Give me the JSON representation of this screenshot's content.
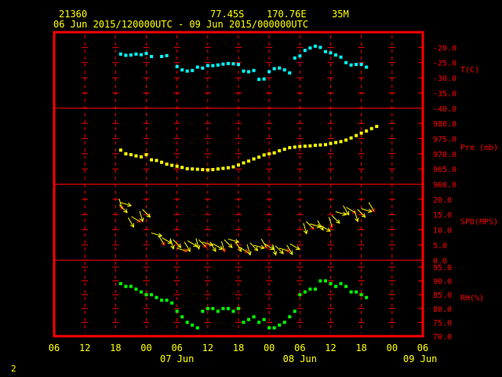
{
  "header": {
    "station": "21360",
    "latitude": "77.45S",
    "longitude": "170.76E",
    "elevation": "35M",
    "time_range": "06 Jun 2015/120000UTC - 09 Jun 2015/000000UTC"
  },
  "footer": {
    "page": "2"
  },
  "colors": {
    "frame": "#ff0000",
    "text": "#ffff00",
    "grid": "#ff0000",
    "temp": "#00ffff",
    "pres": "#ffff00",
    "rh": "#00ff00",
    "wind": "#ffff00",
    "wind_head": "#ff0000"
  },
  "chart_data": {
    "type": "scatter",
    "x_unit": "hours since 06 Jun 2015 00 UTC",
    "xlim": [
      0,
      72
    ],
    "x_tick_labels": [
      "06",
      "12",
      "18",
      "00",
      "06",
      "12",
      "18",
      "00",
      "06",
      "12",
      "18",
      "00",
      "06"
    ],
    "x_day_labels": [
      "07 Jun",
      "08 Jun",
      "09 Jun"
    ],
    "panels": [
      {
        "key": "temp",
        "label": "T(C)",
        "ylim": [
          -40,
          -15
        ],
        "ticks": [
          "-20.0",
          "-25.0",
          "-30.0",
          "-35.0",
          "-40.0"
        ],
        "tick_values": [
          -20,
          -25,
          -30,
          -35,
          -40
        ],
        "points": [
          [
            13,
            -22.2
          ],
          [
            14,
            -22.6
          ],
          [
            15,
            -22.5
          ],
          [
            16,
            -22.2
          ],
          [
            17,
            -22.4
          ],
          [
            18,
            -22
          ],
          [
            19,
            -23
          ],
          [
            21,
            -23
          ],
          [
            22,
            -22.7
          ],
          [
            24,
            -26.3
          ],
          [
            25,
            -27.4
          ],
          [
            26,
            -27.8
          ],
          [
            27,
            -27.6
          ],
          [
            28,
            -26.5
          ],
          [
            29,
            -26.8
          ],
          [
            30,
            -26
          ],
          [
            31,
            -26
          ],
          [
            32,
            -25.8
          ],
          [
            33,
            -25.5
          ],
          [
            34,
            -25.3
          ],
          [
            35,
            -25.4
          ],
          [
            36,
            -25.6
          ],
          [
            37,
            -27.8
          ],
          [
            38,
            -28
          ],
          [
            39,
            -27.6
          ],
          [
            40,
            -30.5
          ],
          [
            41,
            -30.4
          ],
          [
            42,
            -28
          ],
          [
            43,
            -27
          ],
          [
            44,
            -26.8
          ],
          [
            45,
            -27.4
          ],
          [
            46,
            -28.4
          ],
          [
            47,
            -23.5
          ],
          [
            48,
            -22.8
          ],
          [
            49,
            -21
          ],
          [
            50,
            -20.2
          ],
          [
            51,
            -19.6
          ],
          [
            52,
            -20
          ],
          [
            53,
            -21.4
          ],
          [
            54,
            -21.8
          ],
          [
            55,
            -22.5
          ],
          [
            56,
            -23.2
          ],
          [
            57,
            -25
          ],
          [
            58,
            -25.8
          ],
          [
            59,
            -25.6
          ],
          [
            60,
            -25.6
          ],
          [
            61,
            -26.5
          ]
        ]
      },
      {
        "key": "pres",
        "label": "Pre (mb)",
        "ylim": [
          960,
          985
        ],
        "ticks": [
          "980.0",
          "975.0",
          "970.0",
          "965.0",
          "960.0"
        ],
        "tick_values": [
          980,
          975,
          970,
          965,
          960
        ],
        "points": [
          [
            13,
            971.2
          ],
          [
            14,
            970
          ],
          [
            15,
            969.7
          ],
          [
            16,
            969.3
          ],
          [
            17,
            969
          ],
          [
            18,
            969.7
          ],
          [
            19,
            968
          ],
          [
            20,
            967.8
          ],
          [
            21,
            967.2
          ],
          [
            22,
            966.6
          ],
          [
            23,
            966.2
          ],
          [
            24,
            965.9
          ],
          [
            25,
            965.5
          ],
          [
            26,
            965.1
          ],
          [
            27,
            965
          ],
          [
            28,
            964.9
          ],
          [
            29,
            964.8
          ],
          [
            30,
            964.7
          ],
          [
            31,
            964.8
          ],
          [
            32,
            965
          ],
          [
            33,
            965.2
          ],
          [
            34,
            965.4
          ],
          [
            35,
            965.7
          ],
          [
            36,
            966.3
          ],
          [
            37,
            967
          ],
          [
            38,
            967.6
          ],
          [
            39,
            968.3
          ],
          [
            40,
            968.9
          ],
          [
            41,
            969.6
          ],
          [
            42,
            970
          ],
          [
            43,
            970.3
          ],
          [
            44,
            971
          ],
          [
            45,
            971.5
          ],
          [
            46,
            972
          ],
          [
            47,
            972.2
          ],
          [
            48,
            972.4
          ],
          [
            49,
            972.5
          ],
          [
            50,
            972.6
          ],
          [
            51,
            972.8
          ],
          [
            52,
            972.9
          ],
          [
            53,
            973
          ],
          [
            54,
            973.4
          ],
          [
            55,
            973.7
          ],
          [
            56,
            974
          ],
          [
            57,
            974.5
          ],
          [
            58,
            975.2
          ],
          [
            59,
            976
          ],
          [
            60,
            976.8
          ],
          [
            61,
            977.5
          ],
          [
            62,
            978.3
          ],
          [
            63,
            979
          ]
        ]
      },
      {
        "key": "wind",
        "label": "SPD(MPS)",
        "ylim": [
          0,
          25
        ],
        "ticks": [
          "20.0",
          "15.0",
          "10.0",
          "5.0",
          "0.0"
        ],
        "tick_values": [
          20,
          15,
          10,
          5,
          0
        ],
        "points": [
          [
            13,
            20
          ],
          [
            13.5,
            18.5
          ],
          [
            14,
            20
          ],
          [
            15,
            14
          ],
          [
            16,
            15
          ],
          [
            17,
            16
          ],
          [
            18,
            17
          ],
          [
            20,
            10
          ],
          [
            21,
            8
          ],
          [
            22,
            8
          ],
          [
            23,
            7
          ],
          [
            24,
            7
          ],
          [
            25,
            5
          ],
          [
            26,
            6
          ],
          [
            27,
            7
          ],
          [
            28,
            7
          ],
          [
            29,
            7
          ],
          [
            30,
            7
          ],
          [
            31,
            6
          ],
          [
            32,
            6
          ],
          [
            33,
            6
          ],
          [
            34,
            7
          ],
          [
            35,
            8
          ],
          [
            36,
            6
          ],
          [
            37,
            5
          ],
          [
            38,
            5
          ],
          [
            39,
            6
          ],
          [
            40,
            6
          ],
          [
            41,
            7
          ],
          [
            42,
            6
          ],
          [
            43,
            5
          ],
          [
            44,
            5
          ],
          [
            45,
            5
          ],
          [
            46,
            5
          ],
          [
            47,
            6
          ],
          [
            49,
            12
          ],
          [
            50,
            13
          ],
          [
            51,
            13
          ],
          [
            52,
            13
          ],
          [
            53,
            12
          ],
          [
            54,
            14
          ],
          [
            55,
            15
          ],
          [
            56,
            17
          ],
          [
            57,
            18
          ],
          [
            58,
            18
          ],
          [
            59,
            16
          ],
          [
            60,
            17
          ],
          [
            61,
            18
          ],
          [
            62,
            19
          ]
        ]
      },
      {
        "key": "rh",
        "label": "RH(%)",
        "ylim": [
          70,
          97.5
        ],
        "ticks": [
          "95.0",
          "90.0",
          "85.0",
          "80.0",
          "75.0",
          "70.0"
        ],
        "tick_values": [
          95,
          90,
          85,
          80,
          75,
          70
        ],
        "points": [
          [
            13,
            89
          ],
          [
            14,
            88
          ],
          [
            15,
            88
          ],
          [
            16,
            87
          ],
          [
            17,
            86
          ],
          [
            18,
            85
          ],
          [
            19,
            85
          ],
          [
            20,
            84
          ],
          [
            21,
            83
          ],
          [
            22,
            83
          ],
          [
            23,
            82
          ],
          [
            24,
            79
          ],
          [
            25,
            77
          ],
          [
            26,
            75
          ],
          [
            27,
            74
          ],
          [
            28,
            73
          ],
          [
            29,
            79
          ],
          [
            30,
            80
          ],
          [
            31,
            80
          ],
          [
            32,
            79
          ],
          [
            33,
            80
          ],
          [
            34,
            80
          ],
          [
            35,
            79
          ],
          [
            36,
            80
          ],
          [
            37,
            75
          ],
          [
            38,
            76
          ],
          [
            39,
            77
          ],
          [
            40,
            75
          ],
          [
            41,
            76
          ],
          [
            42,
            73
          ],
          [
            43,
            73
          ],
          [
            44,
            74
          ],
          [
            45,
            75
          ],
          [
            46,
            77
          ],
          [
            47,
            79
          ],
          [
            48,
            85
          ],
          [
            49,
            86
          ],
          [
            50,
            87
          ],
          [
            51,
            87
          ],
          [
            52,
            90
          ],
          [
            53,
            90
          ],
          [
            54,
            89
          ],
          [
            55,
            88
          ],
          [
            56,
            89
          ],
          [
            57,
            88
          ],
          [
            58,
            86
          ],
          [
            59,
            86
          ],
          [
            60,
            85
          ],
          [
            61,
            84
          ]
        ]
      }
    ],
    "grid": true
  }
}
